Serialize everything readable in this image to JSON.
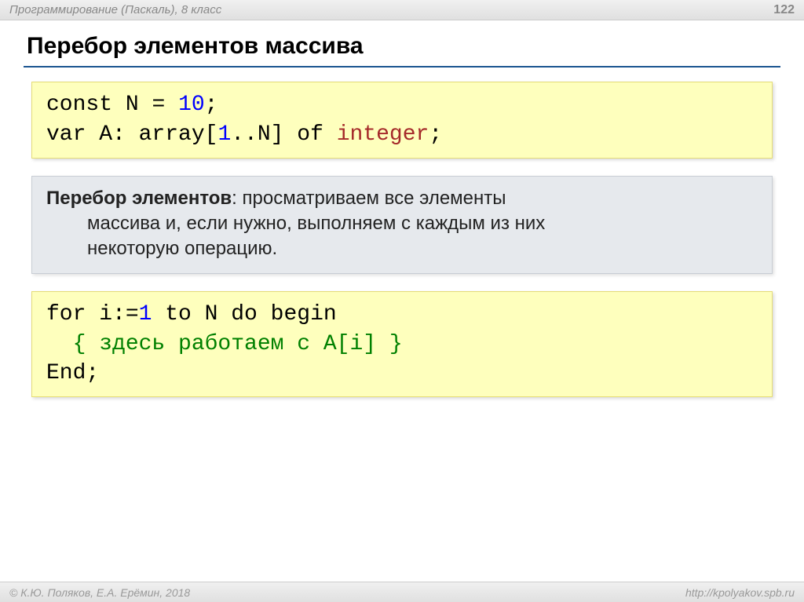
{
  "header": {
    "title": "Программирование (Паскаль), 8 класс",
    "page": "122"
  },
  "main_title": "Перебор элементов массива",
  "code1": {
    "l1": {
      "p1": "const N",
      "eq": "=",
      "val": "10",
      "semi": ";"
    },
    "l2": {
      "p1": "var A: array[",
      "r1": "1",
      "dots": "..N] ",
      "of": "of ",
      "int": "integer",
      "semi": ";"
    }
  },
  "textblock": {
    "bold": "Перебор элементов",
    "rest1": ": просматриваем все элементы",
    "line2": "массива и, если нужно, выполняем с каждым из них",
    "line3": "некоторую операцию."
  },
  "code2": {
    "l1": {
      "p1": "for i:=",
      "one": "1",
      "p2": " to N do begin"
    },
    "l2": "  { здесь работаем с A[i] }",
    "l3": "End;"
  },
  "footer": {
    "left": "© К.Ю. Поляков, Е.А. Ерёмин, 2018",
    "right": "http://kpolyakov.spb.ru"
  }
}
